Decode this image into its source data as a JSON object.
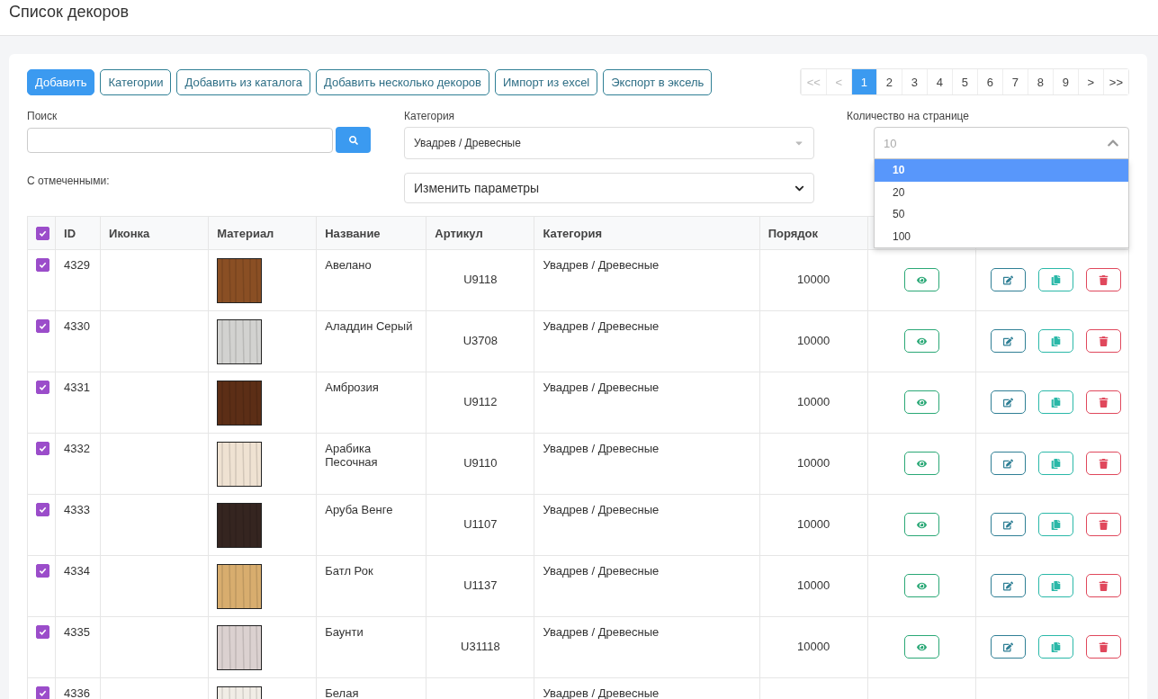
{
  "page_title": "Список декоров",
  "toolbar": [
    {
      "label": "Добавить",
      "kind": "primary"
    },
    {
      "label": "Категории",
      "kind": "outline"
    },
    {
      "label": "Добавить из каталога",
      "kind": "outline"
    },
    {
      "label": "Добавить несколько декоров",
      "kind": "outline"
    },
    {
      "label": "Импорт из excel",
      "kind": "outline"
    },
    {
      "label": "Экспорт в эксель",
      "kind": "outline"
    }
  ],
  "pagination": [
    {
      "label": "<<",
      "selected": false,
      "disabled": true
    },
    {
      "label": "<",
      "selected": false,
      "disabled": true
    },
    {
      "label": "1",
      "selected": true,
      "disabled": false
    },
    {
      "label": "2",
      "selected": false,
      "disabled": false
    },
    {
      "label": "3",
      "selected": false,
      "disabled": false
    },
    {
      "label": "4",
      "selected": false,
      "disabled": false
    },
    {
      "label": "5",
      "selected": false,
      "disabled": false
    },
    {
      "label": "6",
      "selected": false,
      "disabled": false
    },
    {
      "label": "7",
      "selected": false,
      "disabled": false
    },
    {
      "label": "8",
      "selected": false,
      "disabled": false
    },
    {
      "label": "9",
      "selected": false,
      "disabled": false
    },
    {
      "label": ">",
      "selected": false,
      "disabled": false
    },
    {
      "label": ">>",
      "selected": false,
      "disabled": false
    }
  ],
  "search": {
    "label": "Поиск"
  },
  "category_filter": {
    "label": "Категория",
    "value": "Увадрев / Древесные"
  },
  "per_page": {
    "label": "Количество на странице",
    "placeholder": "10",
    "expanded": true,
    "options": [
      {
        "label": "10",
        "selected": true
      },
      {
        "label": "20",
        "selected": false
      },
      {
        "label": "50",
        "selected": false
      },
      {
        "label": "100",
        "selected": false
      }
    ]
  },
  "bulk": {
    "label": "С отмеченными:",
    "value": "Изменить параметры"
  },
  "table": {
    "all_checked": true,
    "columns": [
      "ID",
      "Иконка",
      "Материал",
      "Название",
      "Артикул",
      "Категория",
      "Порядок"
    ],
    "rows": [
      {
        "checked": true,
        "id": "4329",
        "name": "Авелано",
        "article": "U9118",
        "category": "Увадрев / Древесные",
        "order": "10000",
        "color": "#8a4f24"
      },
      {
        "checked": true,
        "id": "4330",
        "name": "Аладдин Серый",
        "article": "U3708",
        "category": "Увадрев / Древесные",
        "order": "10000",
        "color": "#d2d2d0"
      },
      {
        "checked": true,
        "id": "4331",
        "name": "Амброзия",
        "article": "U9112",
        "category": "Увадрев / Древесные",
        "order": "10000",
        "color": "#5c2e16"
      },
      {
        "checked": true,
        "id": "4332",
        "name": "Арабика Песочная",
        "article": "U9110",
        "category": "Увадрев / Древесные",
        "order": "10000",
        "color": "#efe2d2"
      },
      {
        "checked": true,
        "id": "4333",
        "name": "Аруба Венге",
        "article": "U1107",
        "category": "Увадрев / Древесные",
        "order": "10000",
        "color": "#352520"
      },
      {
        "checked": true,
        "id": "4334",
        "name": "Батл Рок",
        "article": "U1137",
        "category": "Увадрев / Древесные",
        "order": "10000",
        "color": "#d8ad6e"
      },
      {
        "checked": true,
        "id": "4335",
        "name": "Баунти",
        "article": "U31118",
        "category": "Увадрев / Древесные",
        "order": "10000",
        "color": "#dbd1d0"
      },
      {
        "checked": true,
        "id": "4336",
        "name": "Белая",
        "category": "Увадрев / Древесные",
        "color": "#f1ede6"
      }
    ]
  }
}
